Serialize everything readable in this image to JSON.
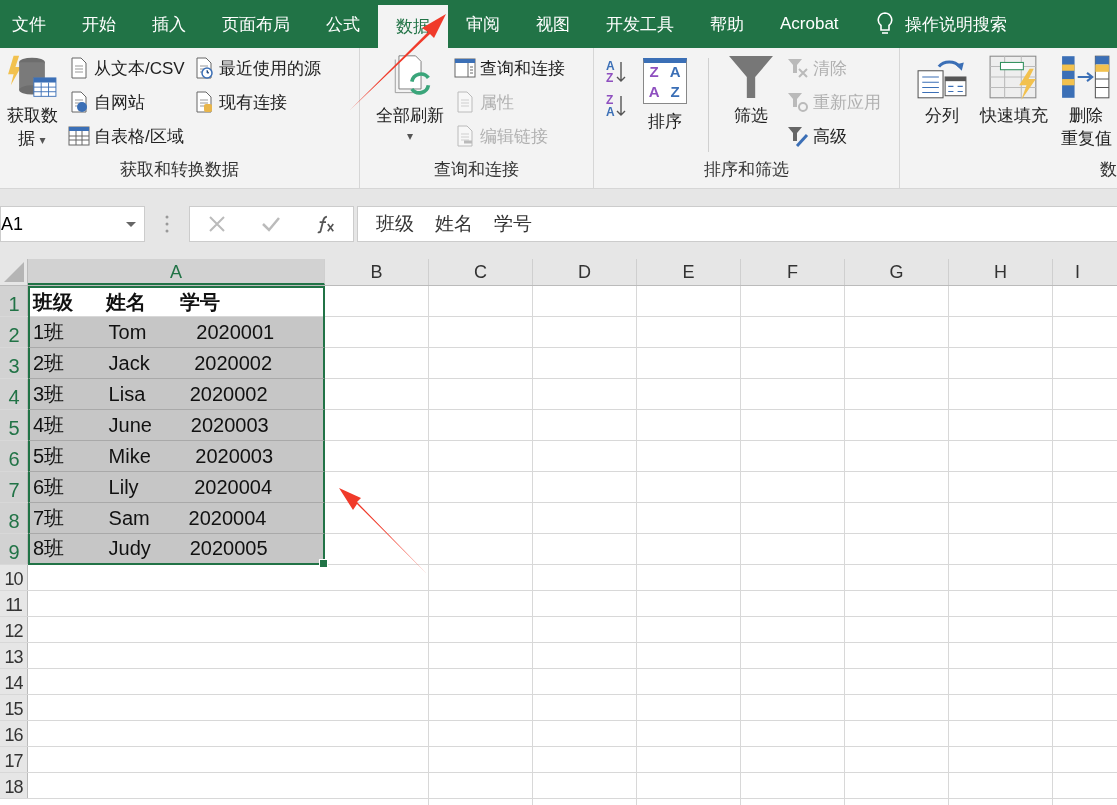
{
  "ribbon_tabs": [
    {
      "label": "文件",
      "selected": false
    },
    {
      "label": "开始",
      "selected": false
    },
    {
      "label": "插入",
      "selected": false
    },
    {
      "label": "页面布局",
      "selected": false
    },
    {
      "label": "公式",
      "selected": false
    },
    {
      "label": "数据",
      "selected": true
    },
    {
      "label": "审阅",
      "selected": false
    },
    {
      "label": "视图",
      "selected": false
    },
    {
      "label": "开发工具",
      "selected": false
    },
    {
      "label": "帮助",
      "selected": false
    },
    {
      "label": "Acrobat",
      "selected": false
    }
  ],
  "tell_me": {
    "label": "操作说明搜索"
  },
  "ribbon_groups": [
    {
      "label": "获取和转换数据",
      "items": [
        {
          "kind": "large",
          "lines": [
            "获取数",
            "据"
          ],
          "caret": "▾"
        },
        {
          "kind": "stack",
          "items": [
            {
              "label": "从文本/CSV",
              "disabled": false
            },
            {
              "label": "自网站",
              "disabled": false
            },
            {
              "label": "自表格/区域",
              "disabled": false
            }
          ]
        },
        {
          "kind": "stack",
          "items": [
            {
              "label": "最近使用的源",
              "disabled": false
            },
            {
              "label": "现有连接",
              "disabled": false
            }
          ]
        }
      ]
    },
    {
      "label": "查询和连接",
      "items": [
        {
          "kind": "large",
          "lines": [
            "全部刷新"
          ],
          "caret": "▾"
        },
        {
          "kind": "stack",
          "items": [
            {
              "label": "查询和连接",
              "disabled": false
            },
            {
              "label": "属性",
              "disabled": true
            },
            {
              "label": "编辑链接",
              "disabled": true
            }
          ]
        }
      ]
    },
    {
      "label": "排序和筛选",
      "items": [
        {
          "kind": "sort_pair",
          "buttons": [
            [
              "A",
              "Z"
            ],
            [
              "Z",
              "A"
            ]
          ]
        },
        {
          "kind": "large",
          "lines": [
            "排序"
          ],
          "glyphs": [
            "Z",
            "A",
            "A",
            "Z"
          ]
        },
        {
          "kind": "separator"
        },
        {
          "kind": "large",
          "lines": [
            "筛选"
          ]
        },
        {
          "kind": "stack",
          "items": [
            {
              "label": "清除",
              "disabled": true
            },
            {
              "label": "重新应用",
              "disabled": true
            },
            {
              "label": "高级",
              "disabled": false
            }
          ]
        }
      ]
    },
    {
      "label": "数",
      "items": [
        {
          "kind": "large",
          "lines": [
            "分列"
          ]
        },
        {
          "kind": "large",
          "lines": [
            "快速填充"
          ]
        },
        {
          "kind": "large",
          "lines": [
            "删除",
            "重复值"
          ]
        }
      ]
    }
  ],
  "formula_bar": {
    "name_box": "A1",
    "formula": "班级    姓名    学号"
  },
  "sheet": {
    "columns": [
      {
        "label": "A",
        "selected": true
      },
      {
        "label": "B",
        "selected": false
      },
      {
        "label": "C",
        "selected": false
      },
      {
        "label": "D",
        "selected": false
      },
      {
        "label": "E",
        "selected": false
      },
      {
        "label": "F",
        "selected": false
      },
      {
        "label": "G",
        "selected": false
      },
      {
        "label": "H",
        "selected": false
      },
      {
        "label": "I",
        "selected": false
      }
    ],
    "rows": [
      {
        "number": "1",
        "selected": true,
        "cells": [
          {
            "text": "班级      姓名      学号",
            "bold": true,
            "selected": true,
            "active": true
          }
        ]
      },
      {
        "number": "2",
        "selected": true,
        "cells": [
          {
            "text": "1班        Tom         2020001",
            "bold": false,
            "selected": true,
            "active": false
          }
        ]
      },
      {
        "number": "3",
        "selected": true,
        "cells": [
          {
            "text": "2班        Jack        2020002",
            "bold": false,
            "selected": true,
            "active": false
          }
        ]
      },
      {
        "number": "4",
        "selected": true,
        "cells": [
          {
            "text": "3班        Lisa        2020002",
            "bold": false,
            "selected": true,
            "active": false
          }
        ]
      },
      {
        "number": "5",
        "selected": true,
        "cells": [
          {
            "text": "4班        June       2020003",
            "bold": false,
            "selected": true,
            "active": false
          }
        ]
      },
      {
        "number": "6",
        "selected": true,
        "cells": [
          {
            "text": "5班        Mike        2020003",
            "bold": false,
            "selected": true,
            "active": false
          }
        ]
      },
      {
        "number": "7",
        "selected": true,
        "cells": [
          {
            "text": "6班        Lily          2020004",
            "bold": false,
            "selected": true,
            "active": false
          }
        ]
      },
      {
        "number": "8",
        "selected": true,
        "cells": [
          {
            "text": "7班        Sam       2020004",
            "bold": false,
            "selected": true,
            "active": false
          }
        ]
      },
      {
        "number": "9",
        "selected": true,
        "cells": [
          {
            "text": "8班        Judy       2020005",
            "bold": false,
            "selected": true,
            "active": false
          }
        ]
      },
      {
        "number": "10",
        "selected": false
      },
      {
        "number": "11",
        "selected": false
      },
      {
        "number": "12",
        "selected": false
      },
      {
        "number": "13",
        "selected": false
      },
      {
        "number": "14",
        "selected": false
      },
      {
        "number": "15",
        "selected": false
      },
      {
        "number": "16",
        "selected": false
      },
      {
        "number": "17",
        "selected": false
      },
      {
        "number": "18",
        "selected": false
      }
    ]
  }
}
